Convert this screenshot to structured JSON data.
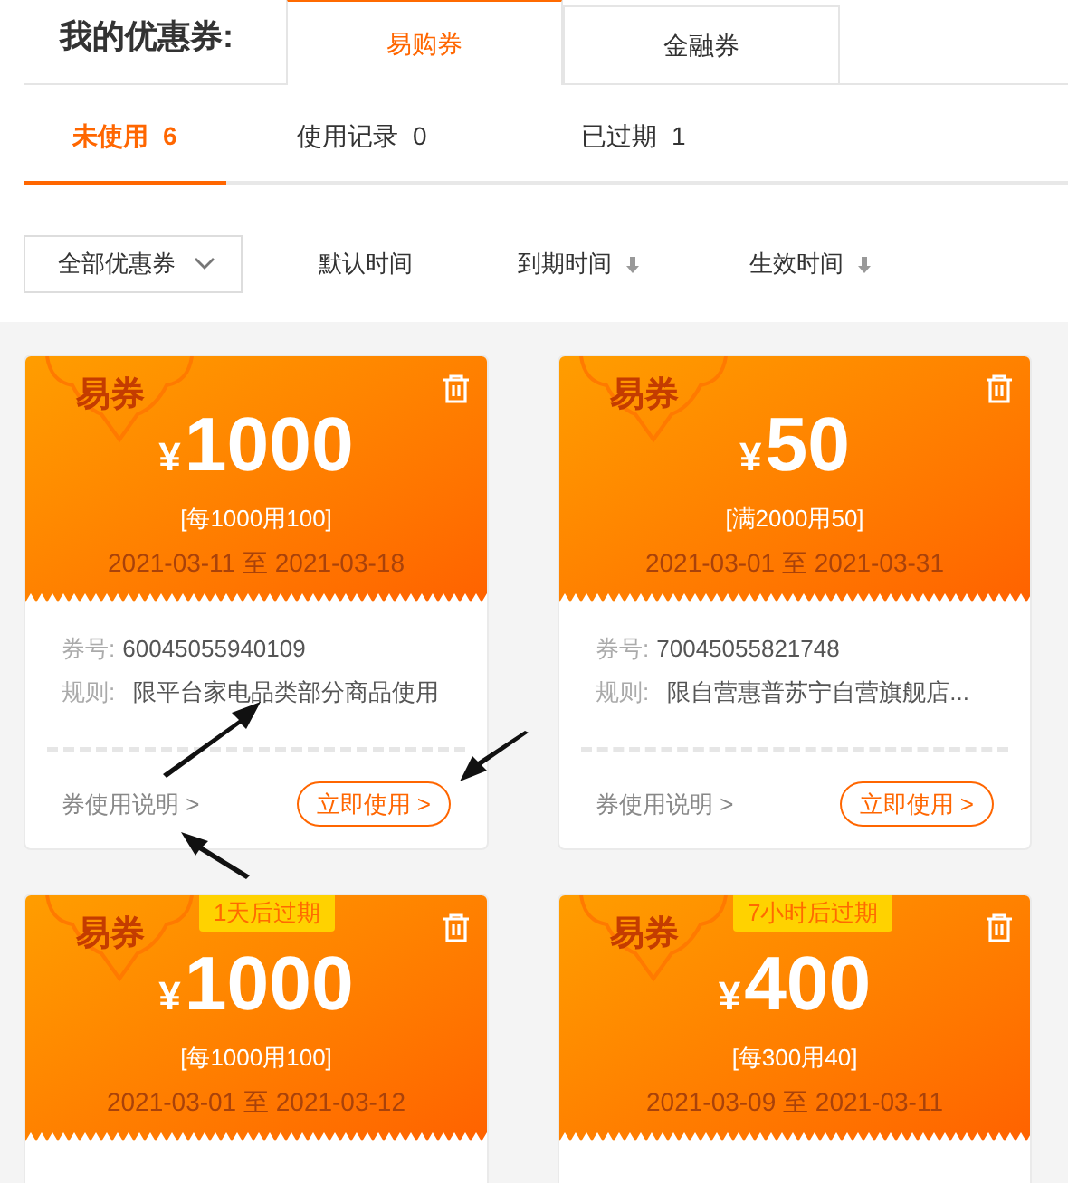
{
  "header": {
    "title": "我的优惠券:"
  },
  "tabs": [
    {
      "label": "易购券",
      "selected": true
    },
    {
      "label": "金融券",
      "selected": false
    }
  ],
  "subtabs": [
    {
      "label": "未使用",
      "count": "6",
      "selected": true
    },
    {
      "label": "使用记录",
      "count": "0",
      "selected": false
    },
    {
      "label": "已过期",
      "count": "1",
      "selected": false
    }
  ],
  "filter": {
    "dropdown": "全部优惠券",
    "sorts": [
      {
        "label": "默认时间",
        "sort_arrow": false
      },
      {
        "label": "到期时间",
        "sort_arrow": true
      },
      {
        "label": "生效时间",
        "sort_arrow": true
      }
    ]
  },
  "coupons": [
    {
      "badge": "易券",
      "currency": "¥",
      "amount": "1000",
      "condition": "[每1000用100]",
      "valid": "2021-03-11 至 2021-03-18",
      "number_label": "券号:",
      "number": "60045055940109",
      "rule_label": "规则:",
      "rule": "限平台家电品类部分商品使用",
      "info_link": "券使用说明 >",
      "use_button": "立即使用 >"
    },
    {
      "badge": "易券",
      "currency": "¥",
      "amount": "50",
      "condition": "[满2000用50]",
      "valid": "2021-03-01 至 2021-03-31",
      "number_label": "券号:",
      "number": "70045055821748",
      "rule_label": "规则:",
      "rule": "限自营惠普苏宁自营旗舰店...",
      "info_link": "券使用说明 >",
      "use_button": "立即使用 >"
    },
    {
      "badge": "易券",
      "expiry_tag": "1天后过期",
      "currency": "¥",
      "amount": "1000",
      "condition": "[每1000用100]",
      "valid": "2021-03-01 至 2021-03-12"
    },
    {
      "badge": "易券",
      "expiry_tag": "7小时后过期",
      "currency": "¥",
      "amount": "400",
      "condition": "[每300用40]",
      "valid": "2021-03-09 至 2021-03-11"
    }
  ]
}
